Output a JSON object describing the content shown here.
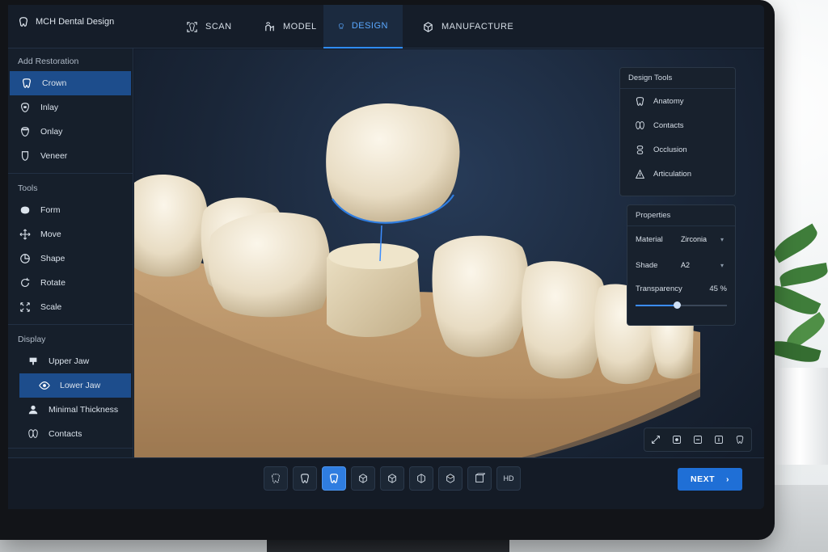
{
  "app": {
    "title": "MCH Dental Design"
  },
  "tabs": [
    {
      "label": "SCAN",
      "icon": "scan-icon"
    },
    {
      "label": "MODEL",
      "icon": "model-icon"
    },
    {
      "label": "DESIGN",
      "icon": "tooth-icon",
      "active": true
    },
    {
      "label": "MANUFACTURE",
      "icon": "manufacture-icon"
    }
  ],
  "sidebar": {
    "add_restoration": {
      "title": "Add Restoration",
      "items": [
        {
          "label": "Crown",
          "icon": "crown-icon",
          "active": true
        },
        {
          "label": "Inlay",
          "icon": "inlay-icon"
        },
        {
          "label": "Onlay",
          "icon": "onlay-icon"
        },
        {
          "label": "Veneer",
          "icon": "veneer-icon"
        }
      ]
    },
    "tools": {
      "title": "Tools",
      "items": [
        {
          "label": "Form",
          "icon": "form-icon"
        },
        {
          "label": "Move",
          "icon": "move-icon"
        },
        {
          "label": "Shape",
          "icon": "shape-icon"
        },
        {
          "label": "Rotate",
          "icon": "rotate-icon"
        },
        {
          "label": "Scale",
          "icon": "scale-icon"
        }
      ]
    },
    "display": {
      "title": "Display",
      "items": [
        {
          "label": "Upper Jaw",
          "icon": "upper-jaw-icon"
        },
        {
          "label": "Lower Jaw",
          "icon": "eye-icon",
          "active": true
        },
        {
          "label": "Minimal Thickness",
          "icon": "thickness-icon"
        },
        {
          "label": "Contacts",
          "icon": "contacts-icon"
        }
      ]
    }
  },
  "design_tools": {
    "title": "Design Tools",
    "items": [
      {
        "label": "Anatomy",
        "icon": "anatomy-icon"
      },
      {
        "label": "Contacts",
        "icon": "contacts-icon"
      },
      {
        "label": "Occlusion",
        "icon": "occlusion-icon"
      },
      {
        "label": "Articulation",
        "icon": "articulation-icon"
      }
    ]
  },
  "properties": {
    "title": "Properties",
    "material_label": "Material",
    "material_value": "Zirconia",
    "shade_label": "Shade",
    "shade_value": "A2",
    "transparency_label": "Transparency",
    "transparency_value": "45 %",
    "transparency_level": 0.45
  },
  "bottom_toolbar": {
    "buttons": [
      "tooth-outline-icon",
      "tooth-icon",
      "tooth-active-icon",
      "cube-icon",
      "cube-icon",
      "cube-icon",
      "cube-icon",
      "cube-icon"
    ],
    "hd_label": "HD",
    "next_label": "NEXT"
  },
  "colors": {
    "accent": "#2f7de0",
    "panel": "#18212d",
    "background": "#131b27"
  }
}
